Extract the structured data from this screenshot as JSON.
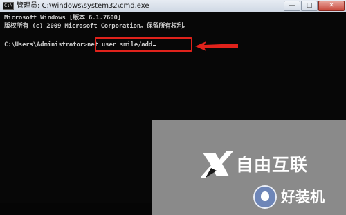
{
  "window": {
    "title": "管理员: C:\\windows\\system32\\cmd.exe",
    "icon": "cmd-icon",
    "controls": {
      "minimize": "—",
      "maximize": "□",
      "close": "✕"
    }
  },
  "console": {
    "version_line": "Microsoft Windows [版本 6.1.7600]",
    "copyright_line": "版权所有 (c) 2009 Microsoft Corporation。保留所有权利。",
    "prompt": "C:\\Users\\Administrator>",
    "command": "net user smile/add"
  },
  "annotation": {
    "highlight_color": "#e0221b"
  },
  "watermark": {
    "brand_text": "自由互联",
    "sub_text": "好装机",
    "background_color": "#8a8a8a"
  }
}
